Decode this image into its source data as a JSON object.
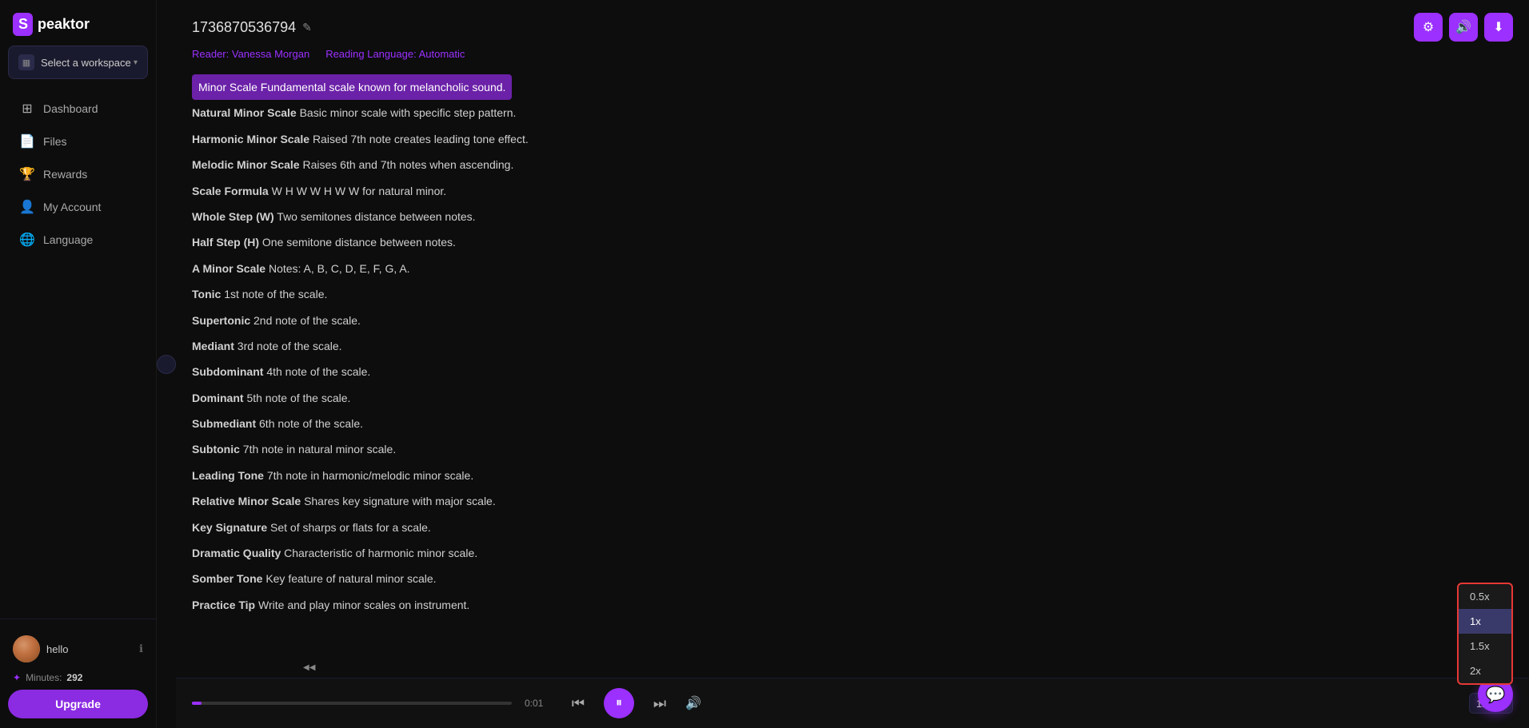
{
  "logo": {
    "box": "S",
    "text": "peaktor"
  },
  "workspace": {
    "label": "Select a workspace",
    "chevron": "▾"
  },
  "nav": {
    "items": [
      {
        "id": "dashboard",
        "label": "Dashboard",
        "icon": "⊞"
      },
      {
        "id": "files",
        "label": "Files",
        "icon": "📄"
      },
      {
        "id": "rewards",
        "label": "Rewards",
        "icon": "🏆"
      },
      {
        "id": "my-account",
        "label": "My Account",
        "icon": "👤"
      },
      {
        "id": "language",
        "label": "Language",
        "icon": "🌐"
      }
    ]
  },
  "user": {
    "name": "hello",
    "minutes_label": "Minutes:",
    "minutes_value": "292"
  },
  "upgrade_label": "Upgrade",
  "document": {
    "title": "1736870536794",
    "reader_label": "Reader: Vanessa Morgan",
    "language_label": "Reading Language: Automatic"
  },
  "content_lines": [
    {
      "term": "Minor Scale",
      "desc": "Fundamental scale known for melancholic sound.",
      "highlighted": true
    },
    {
      "term": "Natural Minor Scale",
      "desc": "Basic minor scale with specific step pattern.",
      "highlighted": false
    },
    {
      "term": "Harmonic Minor Scale",
      "desc": "Raised 7th note creates leading tone effect.",
      "highlighted": false
    },
    {
      "term": "Melodic Minor Scale",
      "desc": "Raises 6th and 7th notes when ascending.",
      "highlighted": false
    },
    {
      "term": "Scale Formula",
      "desc": "W H W W H W W for natural minor.",
      "highlighted": false
    },
    {
      "term": "Whole Step (W)",
      "desc": "Two semitones distance between notes.",
      "highlighted": false
    },
    {
      "term": "Half Step (H)",
      "desc": "One semitone distance between notes.",
      "highlighted": false
    },
    {
      "term": "A Minor Scale",
      "desc": "Notes: A, B, C, D, E, F, G, A.",
      "highlighted": false
    },
    {
      "term": "Tonic",
      "desc": "1st note of the scale.",
      "highlighted": false
    },
    {
      "term": "Supertonic",
      "desc": "2nd note of the scale.",
      "highlighted": false
    },
    {
      "term": "Mediant",
      "desc": "3rd note of the scale.",
      "highlighted": false
    },
    {
      "term": "Subdominant",
      "desc": "4th note of the scale.",
      "highlighted": false
    },
    {
      "term": "Dominant",
      "desc": "5th note of the scale.",
      "highlighted": false
    },
    {
      "term": "Submediant",
      "desc": "6th note of the scale.",
      "highlighted": false
    },
    {
      "term": "Subtonic",
      "desc": "7th note in natural minor scale.",
      "highlighted": false
    },
    {
      "term": "Leading Tone",
      "desc": "7th note in harmonic/melodic minor scale.",
      "highlighted": false
    },
    {
      "term": "Relative Minor Scale",
      "desc": "Shares key signature with major scale.",
      "highlighted": false
    },
    {
      "term": "Key Signature",
      "desc": "Set of sharps or flats for a scale.",
      "highlighted": false
    },
    {
      "term": "Dramatic Quality",
      "desc": "Characteristic of harmonic minor scale.",
      "highlighted": false
    },
    {
      "term": "Somber Tone",
      "desc": "Key feature of natural minor scale.",
      "highlighted": false
    },
    {
      "term": "Practice Tip",
      "desc": "Write and play minor scales on instrument.",
      "highlighted": false
    }
  ],
  "player": {
    "time": "0:01",
    "progress_percent": 3,
    "skip_back_icon": "⏮",
    "pause_icon": "⏸",
    "skip_forward_icon": "⏭",
    "volume_icon": "🔊",
    "speed_label": "1x",
    "speed_chevron": "▾"
  },
  "speed_options": [
    {
      "value": "0.5x",
      "active": false
    },
    {
      "value": "1x",
      "active": true
    },
    {
      "value": "1.5x",
      "active": false
    },
    {
      "value": "2x",
      "active": false
    }
  ],
  "settings_icon": "⚙",
  "tts_icon": "🔊",
  "download_icon": "⬇",
  "edit_icon": "✎",
  "collapse_icon": "◀◀"
}
